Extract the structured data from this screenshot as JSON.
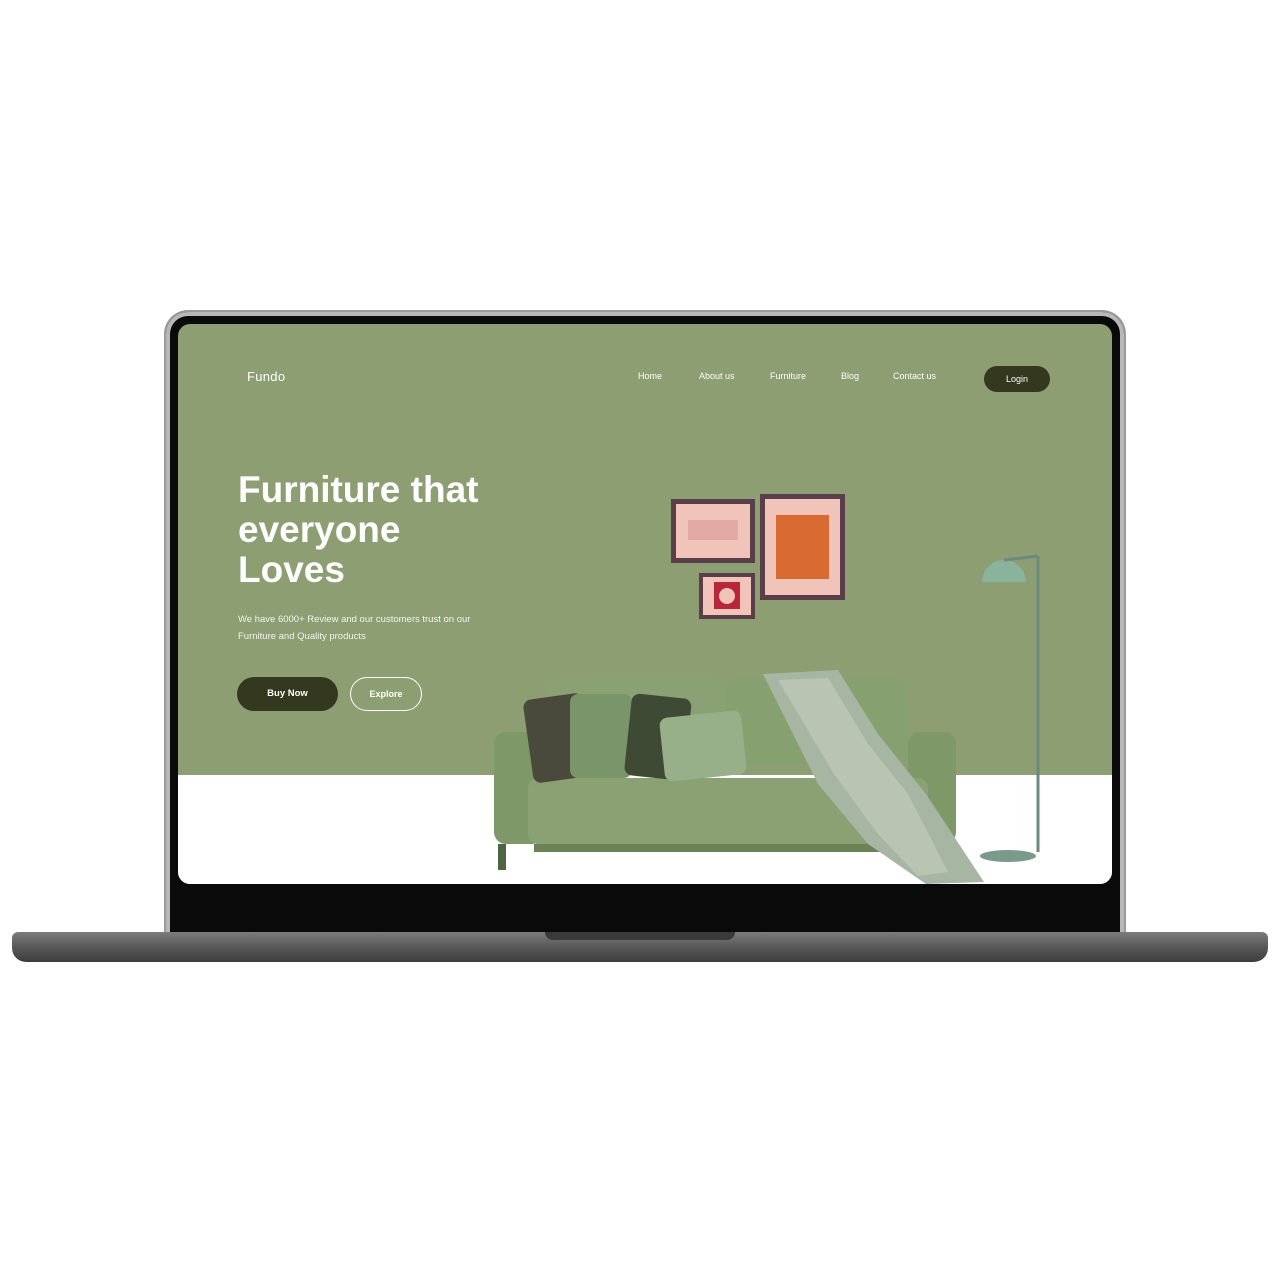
{
  "brand": {
    "name": "Fundo"
  },
  "nav": {
    "items": [
      {
        "label": "Home"
      },
      {
        "label": "About us"
      },
      {
        "label": "Furniture"
      },
      {
        "label": "Blog"
      },
      {
        "label": "Contact us"
      }
    ],
    "login_label": "Login"
  },
  "hero": {
    "title_lines": [
      "Furniture that",
      "everyone",
      "Loves"
    ],
    "subtitle_lines": [
      "We have 6000+ Review and our customers trust on our",
      "Furniture and Quality products"
    ],
    "buy_label": "Buy Now",
    "explore_label": "Explore"
  },
  "colors": {
    "background": "#8c9e72",
    "dark_button": "#33381f",
    "floor": "#ffffff",
    "sofa": "#8aa173",
    "frame": "#5a3e4a",
    "art_orange": "#d96a32",
    "art_pink": "#f0c4b8"
  }
}
